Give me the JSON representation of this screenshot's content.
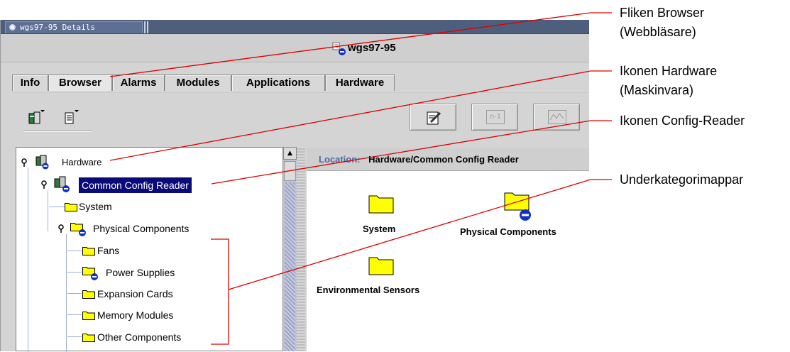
{
  "window": {
    "title": "wgs97-95 Details",
    "host_name": "wgs97-95"
  },
  "tabs": [
    {
      "label": "Info",
      "active": false
    },
    {
      "label": "Browser",
      "active": true
    },
    {
      "label": "Alarms",
      "active": false
    },
    {
      "label": "Modules",
      "active": false
    },
    {
      "label": "Applications",
      "active": false
    },
    {
      "label": "Hardware",
      "active": false
    }
  ],
  "toolbar": {
    "left_icons": [
      "hardware-dropdown-icon",
      "document-dropdown-icon"
    ],
    "buttons": [
      {
        "name": "edit-button",
        "icon": "edit-icon",
        "enabled": true
      },
      {
        "name": "n-1-button",
        "text": "n-1",
        "enabled": false
      },
      {
        "name": "graph-button",
        "icon": "graph-icon",
        "enabled": false
      }
    ]
  },
  "tree": {
    "items": [
      {
        "label": "Hardware",
        "icon": "hardware-icon",
        "selected": false
      },
      {
        "label": "Common Config Reader",
        "icon": "config-reader-icon",
        "selected": true
      },
      {
        "label": "System",
        "icon": "folder-icon",
        "selected": false
      },
      {
        "label": "Physical Components",
        "icon": "folder-icon",
        "selected": false
      },
      {
        "label": "Fans",
        "icon": "folder-icon",
        "selected": false
      },
      {
        "label": "Power Supplies",
        "icon": "folder-icon",
        "selected": false
      },
      {
        "label": "Expansion Cards",
        "icon": "folder-icon",
        "selected": false
      },
      {
        "label": "Memory Modules",
        "icon": "folder-icon",
        "selected": false
      },
      {
        "label": "Other Components",
        "icon": "folder-icon",
        "selected": false
      }
    ]
  },
  "location": {
    "key": "Location:",
    "value": "Hardware/Common Config Reader"
  },
  "content": {
    "items": [
      {
        "label": "System",
        "icon": "folder-icon"
      },
      {
        "label": "Physical Components",
        "icon": "folder-icon"
      },
      {
        "label": "Environmental Sensors",
        "icon": "folder-icon"
      }
    ]
  },
  "annotations": [
    {
      "line1": "Fliken Browser",
      "line2": "(Webbläsare)"
    },
    {
      "line1": "Ikonen Hardware",
      "line2": "(Maskinvara)"
    },
    {
      "line1": "Ikonen Config-Reader",
      "line2": ""
    },
    {
      "line1": "Underkategorimappar",
      "line2": ""
    }
  ],
  "colors": {
    "selection": "#0a0a78",
    "folder": "#ffff00",
    "callout_line": "#e00000",
    "location_key": "#4a6aa8"
  }
}
